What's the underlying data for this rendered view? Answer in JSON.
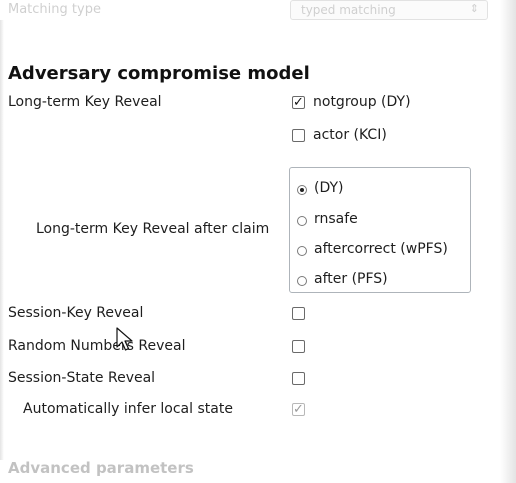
{
  "top": {
    "matching_type_label": "Matching type",
    "matching_type_value": "typed matching"
  },
  "section_title": "Adversary compromise model",
  "long_term_key_reveal": {
    "label": "Long-term Key Reveal",
    "options": [
      {
        "label": "notgroup (DY)",
        "checked": true
      },
      {
        "label": "actor (KCI)",
        "checked": false
      }
    ]
  },
  "lkr_after_claim": {
    "label": "Long-term Key Reveal after claim",
    "options": [
      {
        "label": "(DY)",
        "selected": true
      },
      {
        "label": "rnsafe",
        "selected": false
      },
      {
        "label": "aftercorrect (wPFS)",
        "selected": false
      },
      {
        "label": "after (PFS)",
        "selected": false
      }
    ]
  },
  "session_key_reveal": {
    "label": "Session-Key Reveal",
    "checked": false
  },
  "random_numbers_reveal": {
    "label": "Random Numbers Reveal",
    "checked": false
  },
  "session_state_reveal": {
    "label": "Session-State Reveal",
    "checked": false
  },
  "auto_infer_local_state": {
    "label": "Automatically infer local state",
    "checked": true,
    "enabled": false
  },
  "next_section_title": "Advanced parameters"
}
